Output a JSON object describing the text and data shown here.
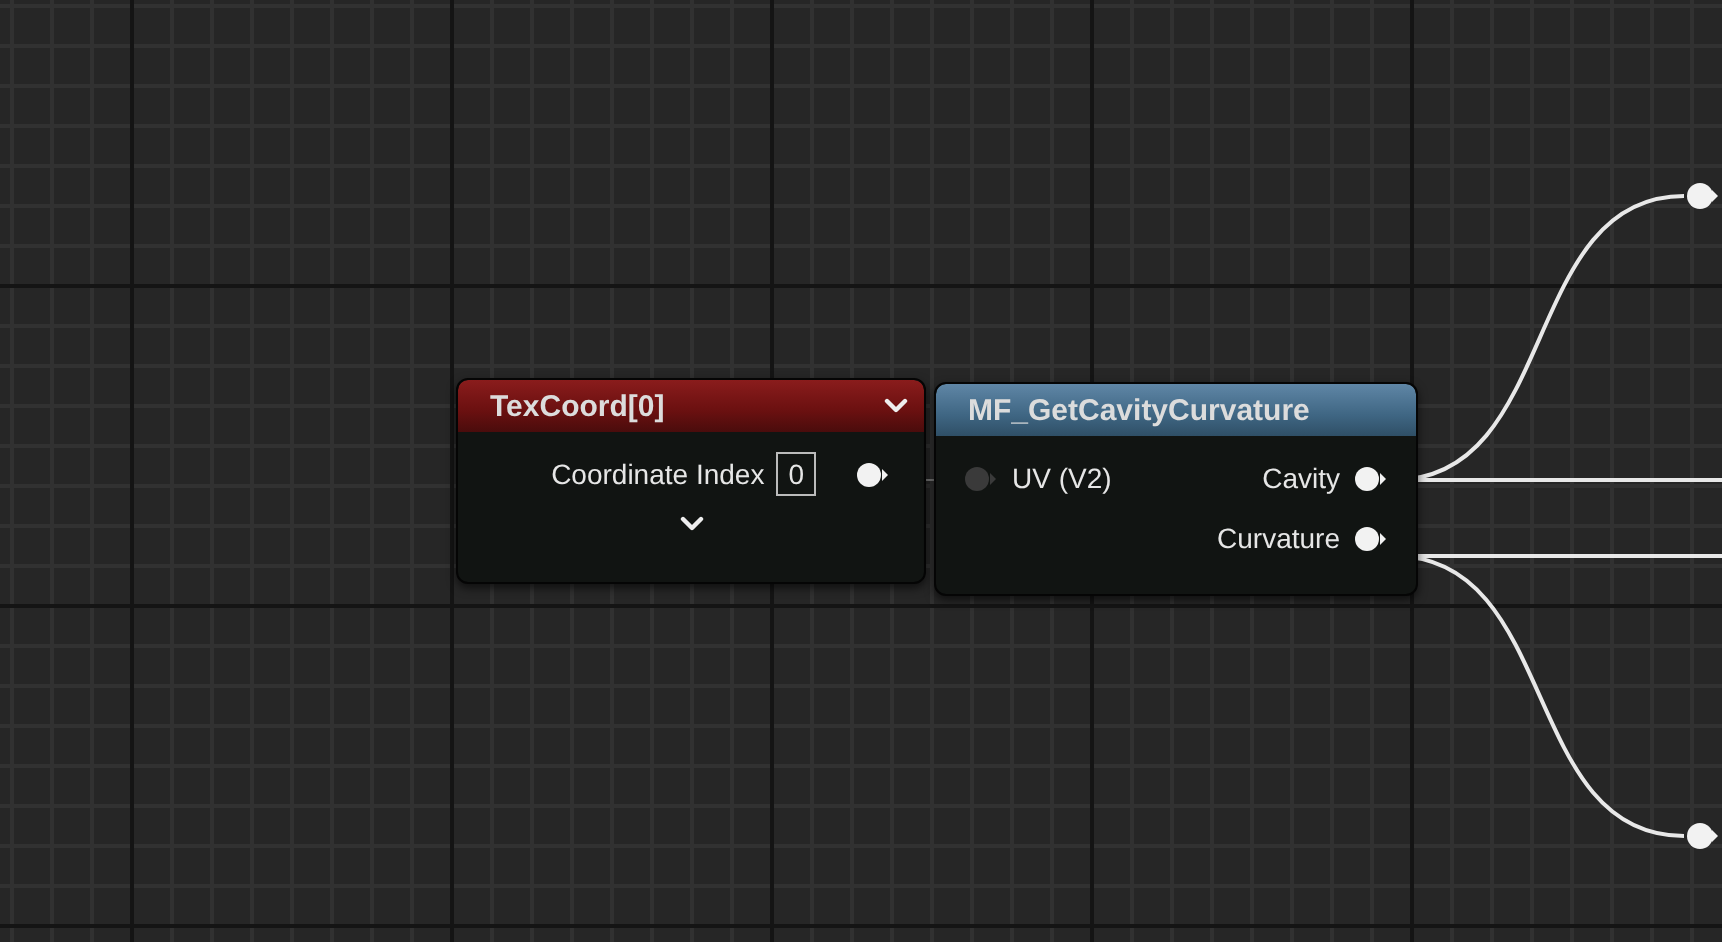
{
  "nodes": [
    {
      "title": "TexCoord[0]",
      "kind": "expression",
      "expandable": true,
      "rows": [
        {
          "label": "Coordinate Index",
          "value": "0",
          "connected": true
        }
      ]
    },
    {
      "title": "MF_GetCavityCurvature",
      "kind": "function",
      "expandable": false,
      "inputs": [
        {
          "label": "UV (V2)",
          "connected": false
        }
      ],
      "outputs": [
        {
          "label": "Cavity",
          "connected": true
        },
        {
          "label": "Curvature",
          "connected": true
        }
      ]
    }
  ]
}
